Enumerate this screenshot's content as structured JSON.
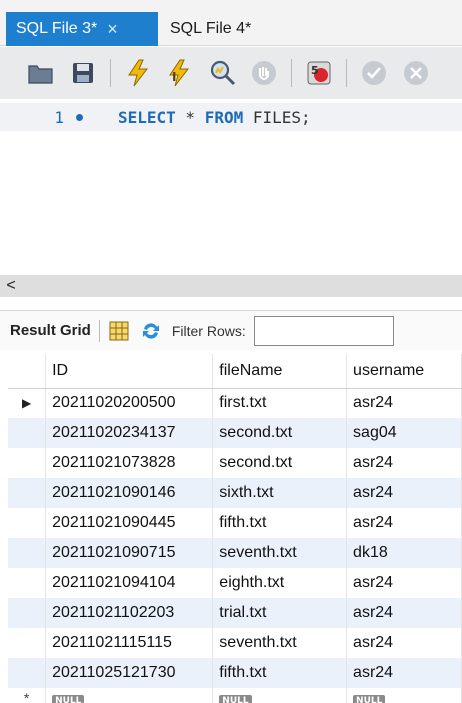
{
  "tabs": [
    {
      "label": "SQL File 3*",
      "active": true
    },
    {
      "label": "SQL File 4*",
      "active": false
    }
  ],
  "tab_close_glyph": "×",
  "editor": {
    "line_number": "1",
    "code": {
      "kw1": "SELECT",
      "star": " * ",
      "kw2": "FROM",
      "rest": " FILES;"
    }
  },
  "scroll_left_glyph": "<",
  "result": {
    "grid_label": "Result Grid",
    "filter_label": "Filter Rows:",
    "filter_value": ""
  },
  "columns": [
    "ID",
    "fileName",
    "username"
  ],
  "rows": [
    [
      "20211020200500",
      "first.txt",
      "asr24"
    ],
    [
      "20211020234137",
      "second.txt",
      "sag04"
    ],
    [
      "20211021073828",
      "second.txt",
      "asr24"
    ],
    [
      "20211021090146",
      "sixth.txt",
      "asr24"
    ],
    [
      "20211021090445",
      "fifth.txt",
      "asr24"
    ],
    [
      "20211021090715",
      "seventh.txt",
      "dk18"
    ],
    [
      "20211021094104",
      "eighth.txt",
      "asr24"
    ],
    [
      "20211021102203",
      "trial.txt",
      "asr24"
    ],
    [
      "20211021115115",
      "seventh.txt",
      "asr24"
    ],
    [
      "20211025121730",
      "fifth.txt",
      "asr24"
    ]
  ],
  "null_label": "NULL",
  "row_pointer_glyph": "▶",
  "new_row_glyph": "*",
  "colors": {
    "accent": "#1e7fcf",
    "keyword": "#1e6bb8",
    "row_alt": "#eaf1fb"
  }
}
